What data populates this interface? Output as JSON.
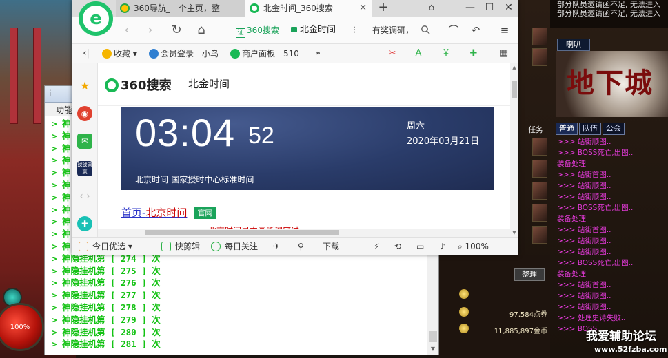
{
  "browser": {
    "tabs": [
      {
        "label": "360导航_一个主页，整",
        "active": false
      },
      {
        "label": "北金时间_360搜索",
        "active": true
      }
    ],
    "address": {
      "search_badge": "360搜索",
      "url": "北金时间",
      "ad_text": "有奖调研，"
    },
    "favorites": [
      {
        "label": "收藏"
      },
      {
        "label": "会员登录 - 小鸟"
      },
      {
        "label": "商户面板 - 510"
      }
    ],
    "search": {
      "logo_text": "360搜索",
      "query": "北金时间"
    },
    "time_card": {
      "hours_minutes": "03:04",
      "seconds": "52",
      "weekday": "周六",
      "date": "2020年03月21日",
      "caption": "北京时间-国家授时中心标准时间"
    },
    "result": {
      "title_prefix": "首页-",
      "title_highlight": "北京时间",
      "badge": "官网",
      "snippet": "北京时间是中国所到底过……"
    },
    "statusbar": {
      "today": "今日优选",
      "clip": "快剪辑",
      "daily": "每日关注",
      "download": "下载",
      "zoom": "100%"
    },
    "sidebar_badge": "球球网赢"
  },
  "console": {
    "title": "i",
    "menu_label": "功能",
    "lines": [
      "> 神隐挂机第 [ 274 ] 次",
      "> 神隐挂机第 [ 275 ] 次",
      "> 神隐挂机第 [ 276 ] 次",
      "> 神隐挂机第 [ 277 ] 次",
      "> 神隐挂机第 [ 278 ] 次",
      "> 神隐挂机第 [ 279 ] 次",
      "> 神隐挂机第 [ 280 ] 次",
      "> 神隐挂机第 [ 281 ] 次"
    ],
    "partial_prefix": "> 神"
  },
  "game": {
    "hp_percent": "100%",
    "party_messages": [
      "部分队员邀请函不足, 无法进入",
      "部分队员邀请函不足, 无法进入"
    ],
    "speaker_tab": "喇叭",
    "logo_text": "地下城",
    "chat_tabs": [
      "普通",
      "队伍",
      "公会"
    ],
    "chat_lines": [
      ">>> 站街顺图..",
      ">>> BOSS死亡,出图..",
      "装备处理",
      ">>> 站街首图..",
      ">>> 站街顺图..",
      ">>> 站街顺图..",
      ">>> BOSS死亡,出图..",
      "装备处理",
      ">>> 站街首图..",
      ">>> 站街顺图..",
      ">>> 站街顺图..",
      ">>> BOSS死亡,出图..",
      "装备处理",
      ">>> 站街首图..",
      ">>> 站街顺图..",
      ">>> 站街顺图..",
      ">>> 处理史诗失败..",
      ">>> BOSS"
    ],
    "tidy_button": "整理",
    "side_label": "任务",
    "voucher_amount": "97,584点券",
    "gold_amount": "11,885,897金币",
    "watermark": "我爱辅助论坛",
    "watermark_url": "www.52fzba.com"
  }
}
